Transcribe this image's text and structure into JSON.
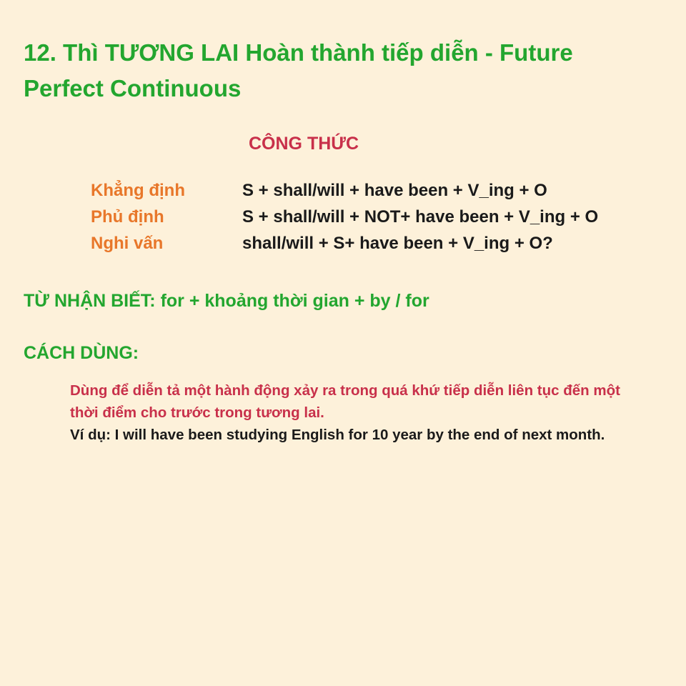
{
  "title": "12. Thì TƯƠNG LAI Hoàn thành tiếp diễn - Future Perfect Continuous",
  "formula_heading": "CÔNG THỨC",
  "formulas": [
    {
      "label": "Khẳng định",
      "expr": "S + shall/will + have been + V_ing + O"
    },
    {
      "label": "Phủ định",
      "expr": "S + shall/will + NOT+ have been + V_ing + O"
    },
    {
      "label": "Nghi vấn",
      "expr": "shall/will + S+ have been + V_ing + O?"
    }
  ],
  "signal_words": "TỪ NHẬN BIẾT: for + khoảng thời gian + by / for",
  "usage_heading": "CÁCH DÙNG:",
  "usage_description": "Dùng để diễn tả một hành động xảy ra trong quá khứ tiếp diễn liên tục đến một thời điểm cho trước trong tương lai.",
  "usage_example": "Ví dụ: I will have been studying English for 10 year by the end of next month.",
  "colors": {
    "background": "#fdf1da",
    "title_green": "#23a62f",
    "heading_red": "#c8304a",
    "label_orange": "#e8772a",
    "text_dark": "#1a1a1a"
  }
}
